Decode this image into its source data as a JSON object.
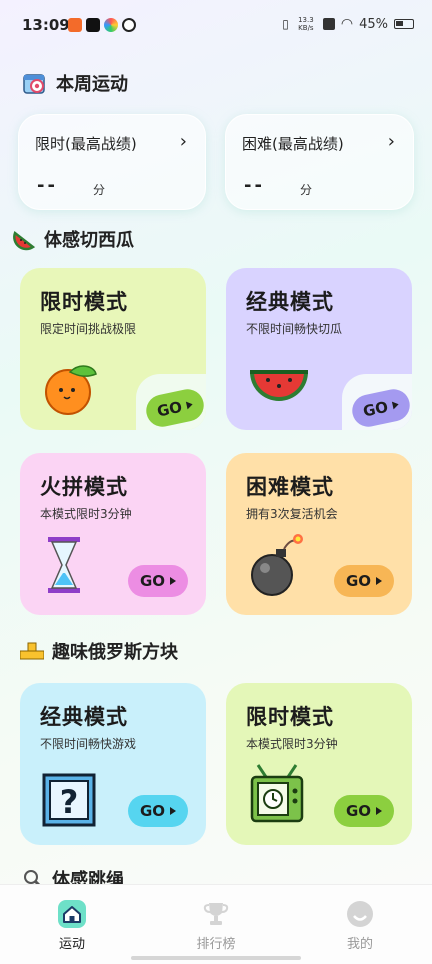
{
  "status_bar": {
    "time": "13:09",
    "network_speed": "13.3 KB/s",
    "battery": "45%"
  },
  "weekly": {
    "title": "本周运动",
    "cards": [
      {
        "label": "限时(最高战绩)",
        "value": "--",
        "unit": "分"
      },
      {
        "label": "困难(最高战绩)",
        "value": "--",
        "unit": "分"
      }
    ]
  },
  "watermelon": {
    "title": "体感切西瓜",
    "modes": [
      {
        "title": "限时模式",
        "subtitle": "限定时间挑战极限",
        "go": "GO",
        "illustration": "orange-icon",
        "bg": "#e8f7b9",
        "btn": "#8ccf3f"
      },
      {
        "title": "经典模式",
        "subtitle": "不限时间畅快切瓜",
        "go": "GO",
        "illustration": "watermelon-icon",
        "bg": "#d9d3ff",
        "btn": "#a49af0"
      },
      {
        "title": "火拼模式",
        "subtitle": "本模式限时3分钟",
        "go": "GO",
        "illustration": "hourglass-icon",
        "bg": "#fbd4f4",
        "btn": "#ec8de3"
      },
      {
        "title": "困难模式",
        "subtitle": "拥有3次复活机会",
        "go": "GO",
        "illustration": "bomb-icon",
        "bg": "#ffe0a8",
        "btn": "#f7b655"
      }
    ]
  },
  "tetris": {
    "title": "趣味俄罗斯方块",
    "modes": [
      {
        "title": "经典模式",
        "subtitle": "不限时间畅快游戏",
        "go": "GO",
        "illustration": "question-block-icon",
        "bg": "#c9f0fb",
        "btn": "#56d5f0"
      },
      {
        "title": "限时模式",
        "subtitle": "本模式限时3分钟",
        "go": "GO",
        "illustration": "tv-icon",
        "bg": "#e4f7b8",
        "btn": "#8ccf3f"
      }
    ]
  },
  "jump_rope": {
    "title": "体感跳绳"
  },
  "nav": [
    {
      "label": "运动",
      "icon": "home-icon",
      "active": true
    },
    {
      "label": "排行榜",
      "icon": "trophy-icon",
      "active": false
    },
    {
      "label": "我的",
      "icon": "profile-icon",
      "active": false
    }
  ]
}
